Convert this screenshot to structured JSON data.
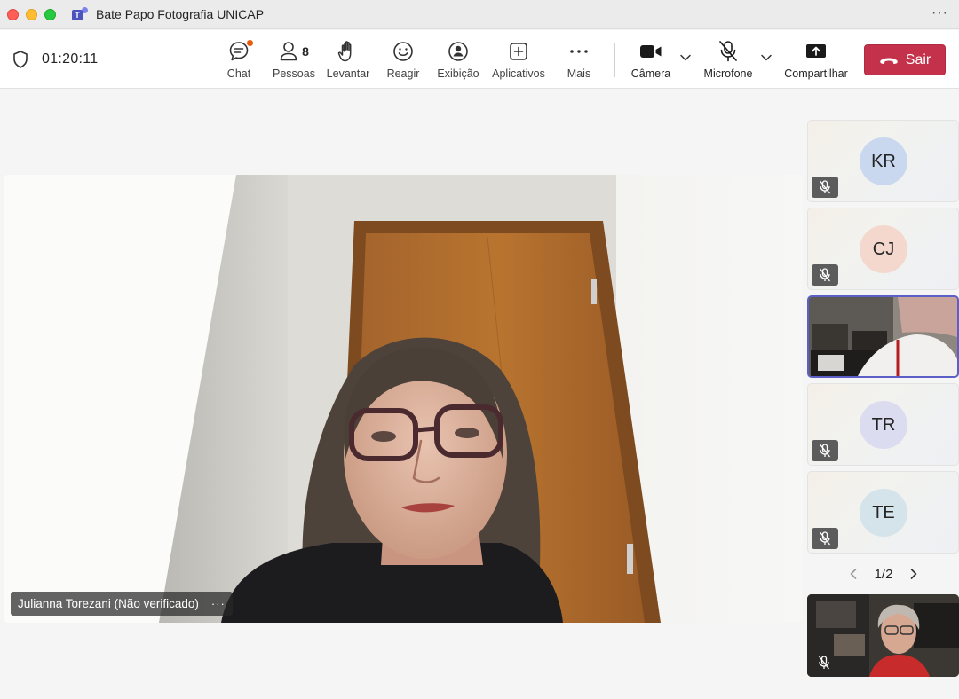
{
  "window": {
    "title": "Bate Papo Fotografia UNICAP",
    "logo_letter": "T"
  },
  "meeting": {
    "timer": "01:20:11"
  },
  "toolbar": {
    "chat": "Chat",
    "people": "Pessoas",
    "people_count": "8",
    "raise": "Levantar",
    "react": "Reagir",
    "view": "Exibição",
    "apps": "Aplicativos",
    "more": "Mais",
    "camera": "Câmera",
    "mic": "Microfone",
    "share": "Compartilhar",
    "leave": "Sair"
  },
  "main_video": {
    "participant": "Julianna Torezani (Não verificado)",
    "more": "···"
  },
  "tiles": [
    {
      "initials": "KR",
      "color": "#c9d8ef"
    },
    {
      "initials": "CJ",
      "color": "#f4d8ce"
    },
    {
      "initials": "",
      "video": true
    },
    {
      "initials": "TR",
      "color": "#dcdcf0"
    },
    {
      "initials": "TE",
      "color": "#d5e3ea"
    }
  ],
  "pager": {
    "label": "1/2"
  },
  "colors": {
    "leave": "#c4314b",
    "active_border": "#5b5fc7",
    "brand": "#4b53bc",
    "badge": "#e8590c"
  }
}
